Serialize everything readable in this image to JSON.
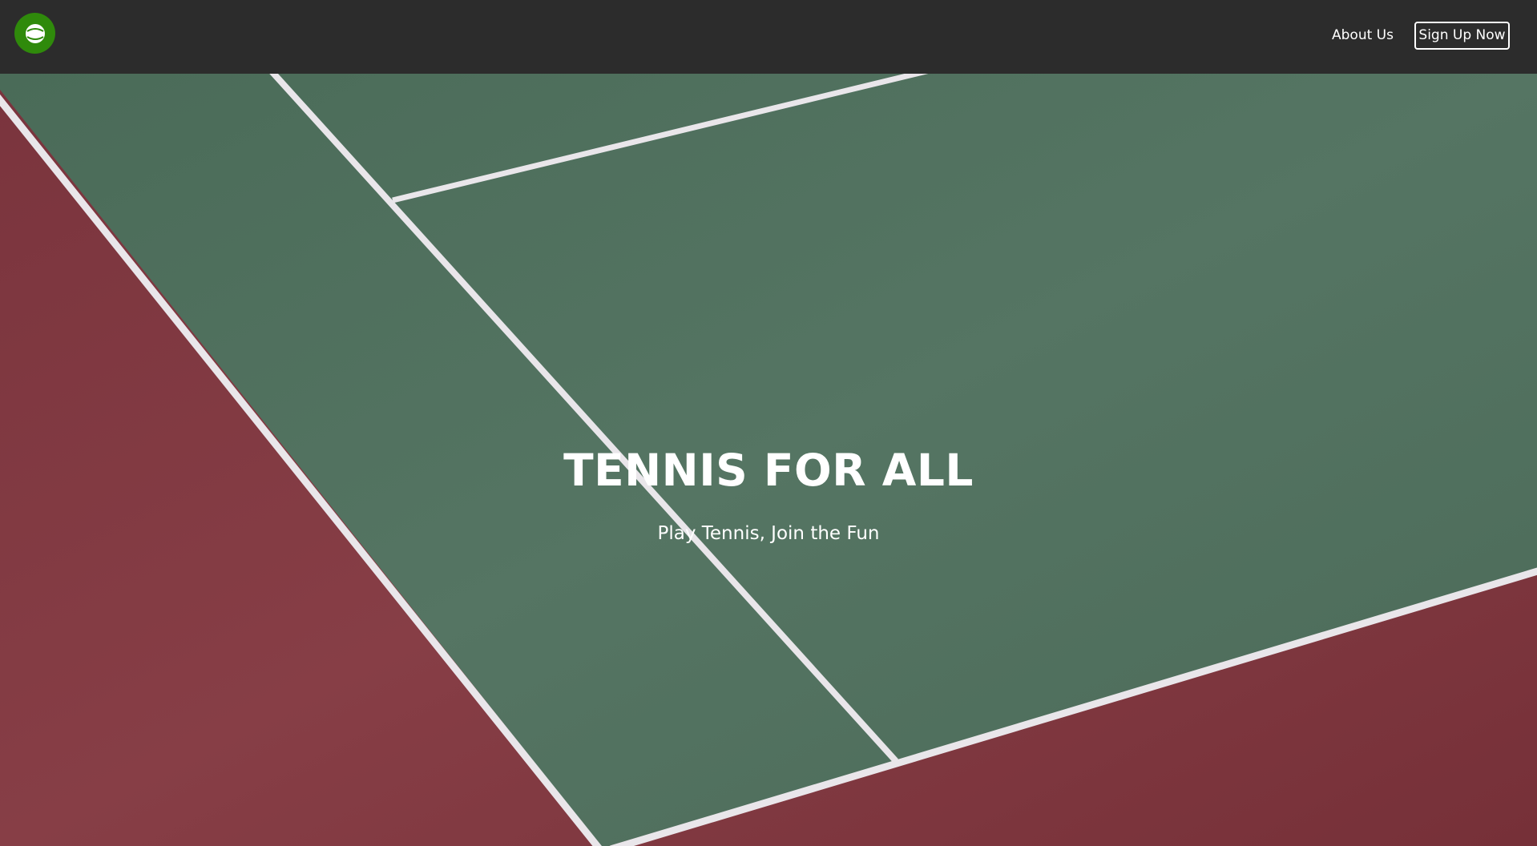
{
  "header": {
    "logo_icon": "tennis-ball-logo-icon",
    "nav": {
      "about_label": "About Us",
      "signup_label": "Sign Up Now"
    }
  },
  "hero": {
    "title": "TENNIS FOR ALL",
    "subtitle": "Play Tennis, Join the Fun",
    "background": "tennis-court-image"
  },
  "colors": {
    "navbar": "#2c2c2c",
    "logo_green": "#2f8a0b",
    "court_green": "#4e6e5c",
    "court_red": "#7f3a42",
    "line_white": "#e9e6ea",
    "text": "#ffffff"
  }
}
